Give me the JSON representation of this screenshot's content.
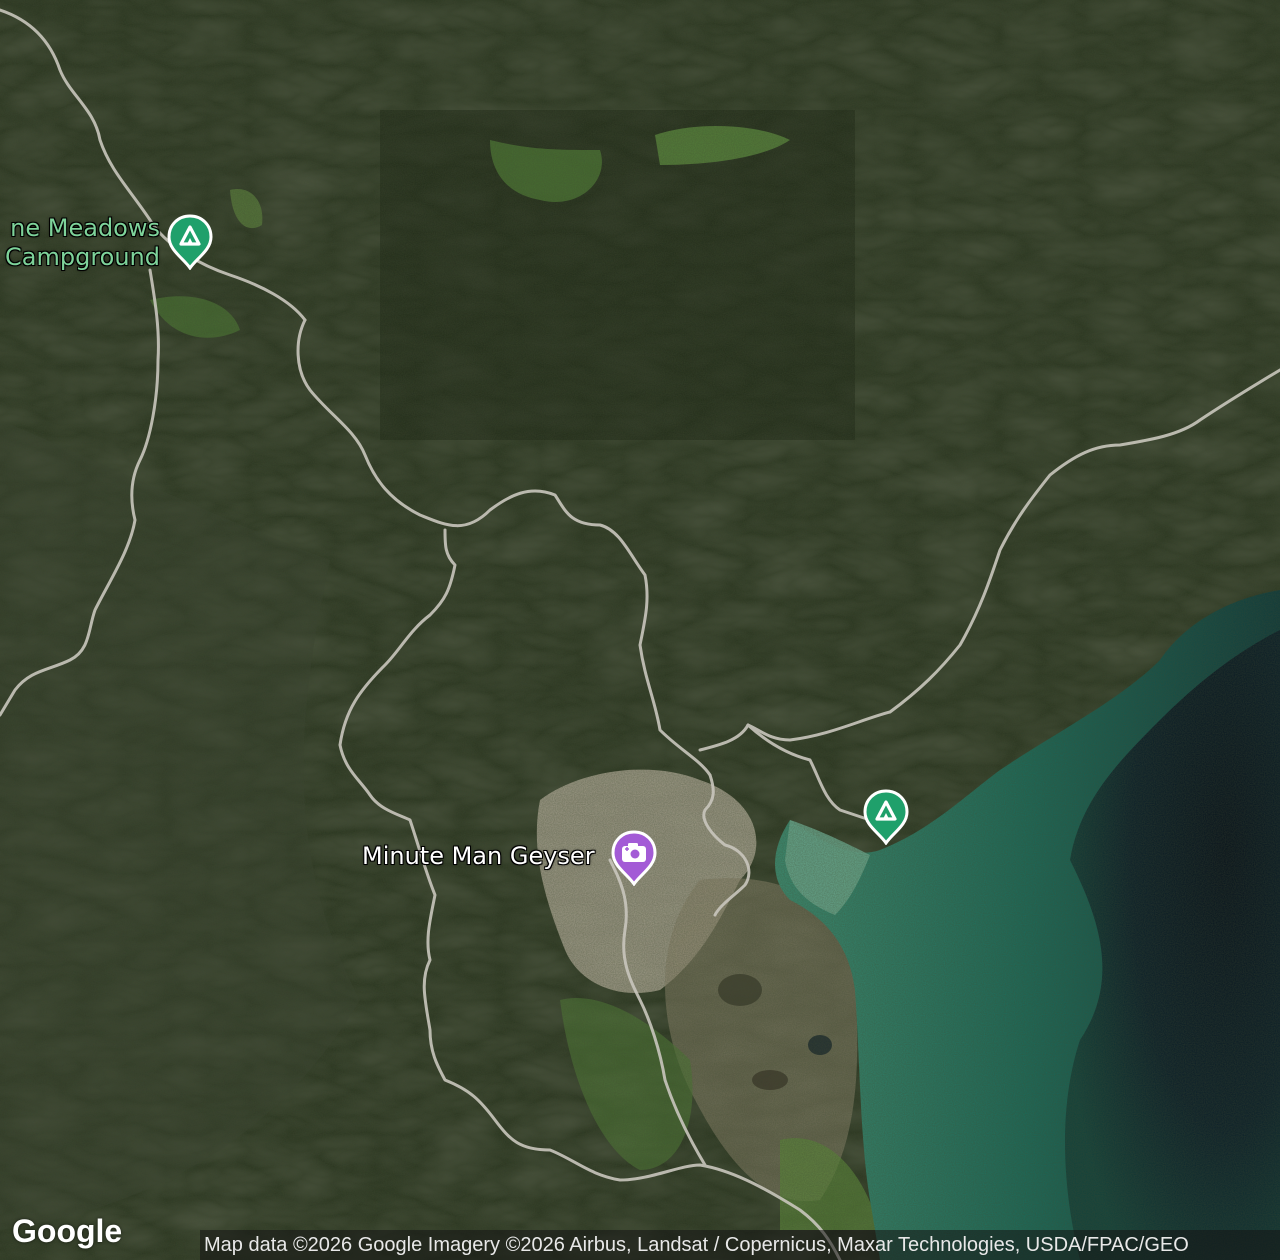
{
  "map": {
    "type": "satellite",
    "colors": {
      "camp_marker": "#1fa06b",
      "camp_label": "#7ed39a",
      "geyser_marker": "#a35bd6",
      "geyser_label": "#ffffff",
      "road": "#c9c6bd",
      "lake_shallow": "#5e9e86",
      "lake_deep": "#0b1a26",
      "forest": "#27331d"
    },
    "markers": [
      {
        "id": "camp-north",
        "type": "campground",
        "icon": "campground-icon",
        "label_line1": "ne Meadows",
        "label_line2": "Campground"
      },
      {
        "id": "geyser",
        "type": "attraction",
        "icon": "camera-icon",
        "label": "Minute Man Geyser"
      },
      {
        "id": "camp-lake",
        "type": "campground",
        "icon": "campground-icon"
      }
    ],
    "attribution": "Map data ©2026 Google Imagery ©2026 Airbus, Landsat / Copernicus, Maxar Technologies, USDA/FPAC/GEO",
    "logo": "Google"
  }
}
